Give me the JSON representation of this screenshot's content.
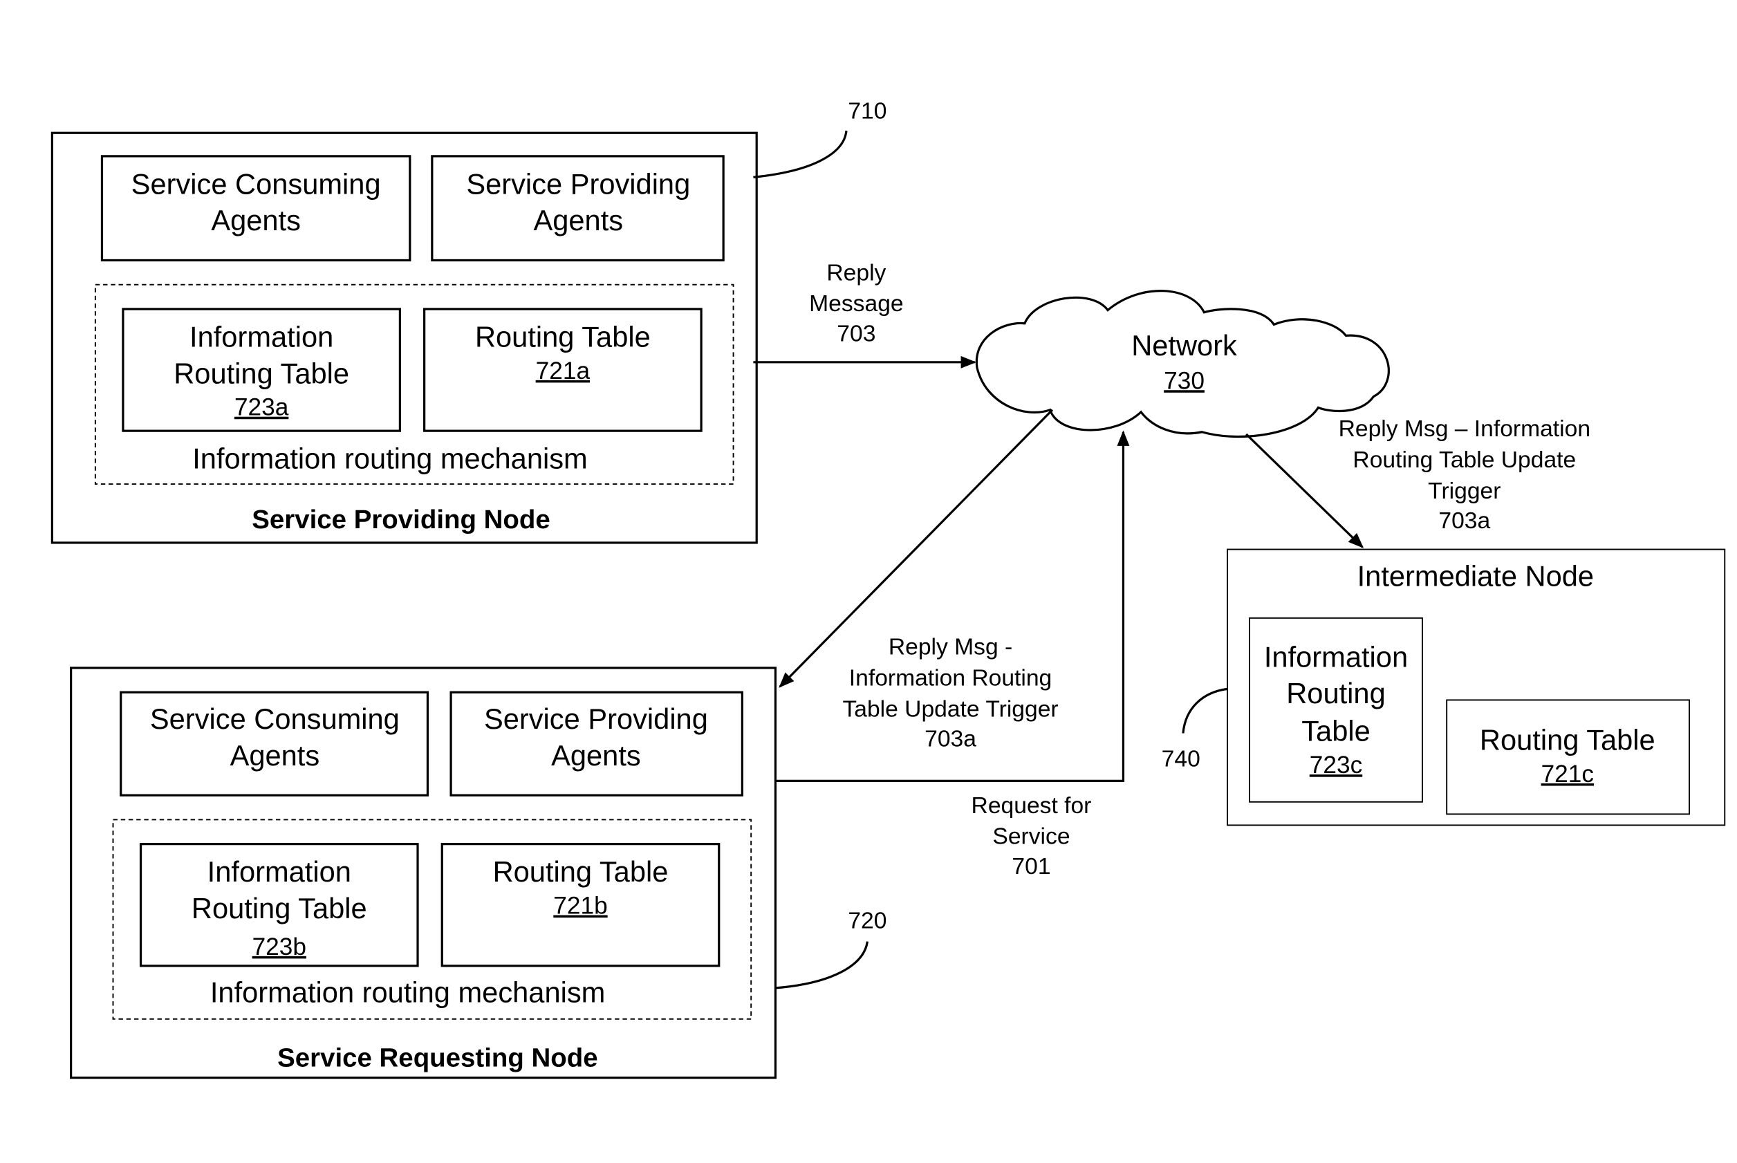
{
  "provider_node": {
    "title": "Service Providing Node",
    "ref": "710",
    "consuming_agents": [
      "Service Consuming",
      "Agents"
    ],
    "providing_agents": [
      "Service Providing",
      "Agents"
    ],
    "info_table": [
      "Information",
      "Routing Table"
    ],
    "info_table_ref": "723a",
    "routing_table": "Routing Table",
    "routing_table_ref": "721a",
    "mechanism": "Information routing mechanism"
  },
  "requester_node": {
    "title": "Service Requesting Node",
    "ref": "720",
    "consuming_agents": [
      "Service Consuming",
      "Agents"
    ],
    "providing_agents": [
      "Service Providing",
      "Agents"
    ],
    "info_table": [
      "Information",
      "Routing Table"
    ],
    "info_table_ref": "723b",
    "routing_table": "Routing Table",
    "routing_table_ref": "721b",
    "mechanism": "Information routing mechanism"
  },
  "intermediate_node": {
    "title": "Intermediate Node",
    "ref": "740",
    "info_table": [
      "Information",
      "Routing",
      "Table"
    ],
    "info_table_ref": "723c",
    "routing_table": "Routing Table",
    "routing_table_ref": "721c"
  },
  "network": {
    "label": "Network",
    "ref": "730"
  },
  "messages": {
    "reply": [
      "Reply",
      "Message",
      "703"
    ],
    "reply_trigger_right": [
      "Reply Msg – Information",
      "Routing Table Update",
      "Trigger",
      "703a"
    ],
    "reply_trigger_left": [
      "Reply Msg -",
      "Information Routing",
      "Table Update Trigger",
      "703a"
    ],
    "request": [
      "Request for",
      "Service",
      "701"
    ]
  }
}
